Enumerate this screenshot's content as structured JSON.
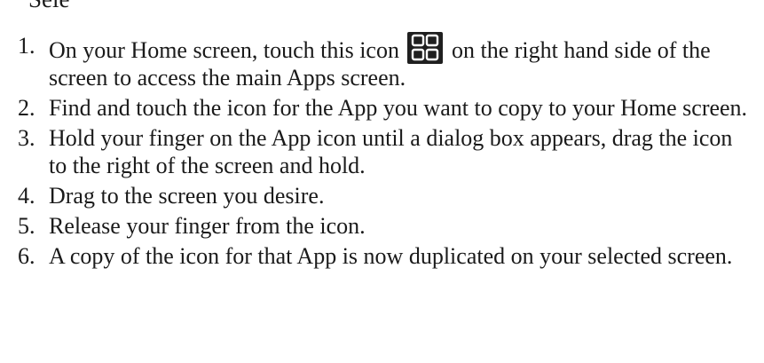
{
  "heading_fragment": "Sele",
  "icons": {
    "apps": "apps-grid-icon"
  },
  "colors": {
    "text": "#1a1a1a",
    "icon_bg": "#1f1f1f",
    "icon_fg": "#ffffff"
  },
  "steps": [
    {
      "num": "1.",
      "before": "On your Home screen, touch this icon",
      "after": "on the right hand side of the screen to access the main Apps screen."
    },
    {
      "num": "2.",
      "text": "Find and touch the icon for the App you want to copy to your Home screen."
    },
    {
      "num": "3.",
      "text": "Hold your finger on the App icon until a dialog box appears, drag the icon to the right of the screen and hold."
    },
    {
      "num": "4.",
      "text": "Drag to the screen you desire."
    },
    {
      "num": "5.",
      "text": "Release your finger from the icon."
    },
    {
      "num": "6.",
      "text": "A copy of the icon for that App is now duplicated on your selected screen."
    }
  ]
}
